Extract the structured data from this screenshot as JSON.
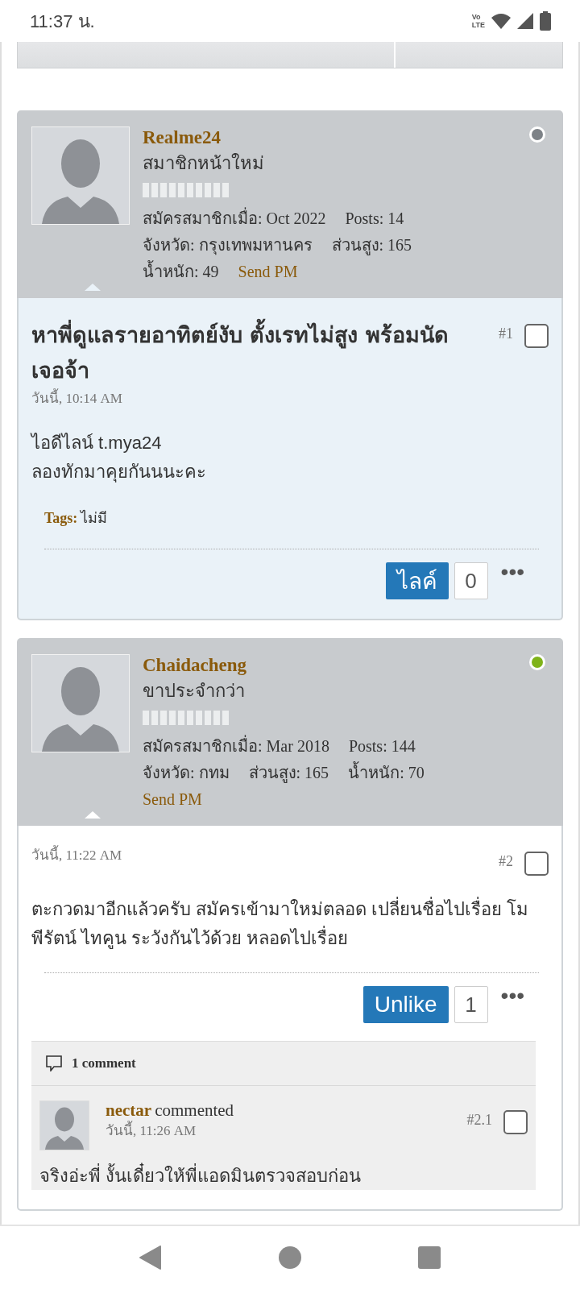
{
  "status_bar": {
    "time": "11:37 น.",
    "network_top": "Vo",
    "network_bottom": "LTE"
  },
  "posts": [
    {
      "author": {
        "name": "Realme24",
        "rank": "สมาชิกหน้าใหม่",
        "online": false,
        "stats": [
          "สมัครสมาชิกเมื่อ: Oct 2022",
          "Posts: 14",
          "จังหวัด: กรุงเทพมหานคร",
          "ส่วนสูง: 165",
          "น้ำหนัก: 49"
        ],
        "send_pm": "Send PM"
      },
      "highlighted": true,
      "title": "หาพี่ดูแลรายอาทิตย์งับ ตั้งเรทไม่สูง พร้อมนัดเจอจ้า",
      "time": "วันนี้, 10:14 AM",
      "number": "#1",
      "checked": false,
      "body": [
        "ไอดีไลน์ t.mya24",
        "ลองทักมาคุยกันนนะคะ"
      ],
      "tags_label": "Tags:",
      "tags": "ไม่มี",
      "like": {
        "label": "ไลค์",
        "count": "0"
      },
      "more": "•••"
    },
    {
      "author": {
        "name": "Chaidacheng",
        "rank": "ขาประจำกว่า",
        "online": true,
        "stats": [
          "สมัครสมาชิกเมื่อ: Mar 2018",
          "Posts: 144",
          "จังหวัด: กทม",
          "ส่วนสูง: 165",
          "น้ำหนัก: 70"
        ],
        "send_pm": "Send PM"
      },
      "highlighted": false,
      "time": "วันนี้, 11:22 AM",
      "number": "#2",
      "checked": false,
      "body": [
        "ตะกวดมาอีกแล้วครับ สมัครเข้ามาใหม่ตลอด เปลี่ยนชื่อไปเรื่อย โมพีรัตน์ ไทคูน ระวังกันไว้ด้วย หลอดไปเรื่อย"
      ],
      "like": {
        "label": "Unlike",
        "count": "1"
      },
      "more": "•••",
      "comments": {
        "count_label": "1 comment",
        "items": [
          {
            "author": "nectar",
            "verb": "commented",
            "time": "วันนี้, 11:26 AM",
            "number": "#2.1",
            "checked": false,
            "text": "จริงอ่ะพี่ งั้นเดี๋ยวให้พี่แอดมินตรวจสอบก่อน"
          }
        ]
      }
    }
  ]
}
